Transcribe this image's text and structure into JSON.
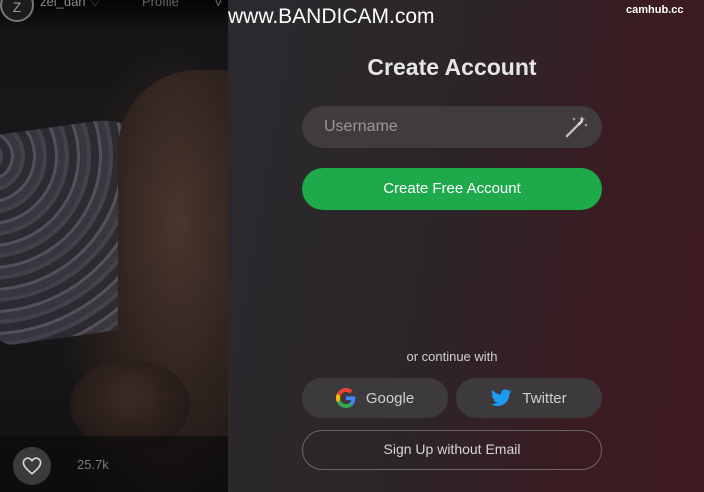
{
  "video": {
    "user_initial": "Z",
    "username": "zel_dan ♡",
    "profile_tab": "Profile",
    "more_tab": "V",
    "likes": "25.7k",
    "heart_icon": "heart-icon"
  },
  "watermarks": {
    "bandicam": "www.BANDICAM.com",
    "camhub": "camhub.cc"
  },
  "signup": {
    "title": "Create Account",
    "username_placeholder": "Username",
    "wand_icon": "magic-wand-icon",
    "create_button": "Create Free Account",
    "or_text": "or continue with",
    "google_label": "Google",
    "twitter_label": "Twitter",
    "no_email_label": "Sign Up without Email"
  },
  "colors": {
    "accent_green": "#1ea94a",
    "twitter_blue": "#1d9bf0"
  }
}
